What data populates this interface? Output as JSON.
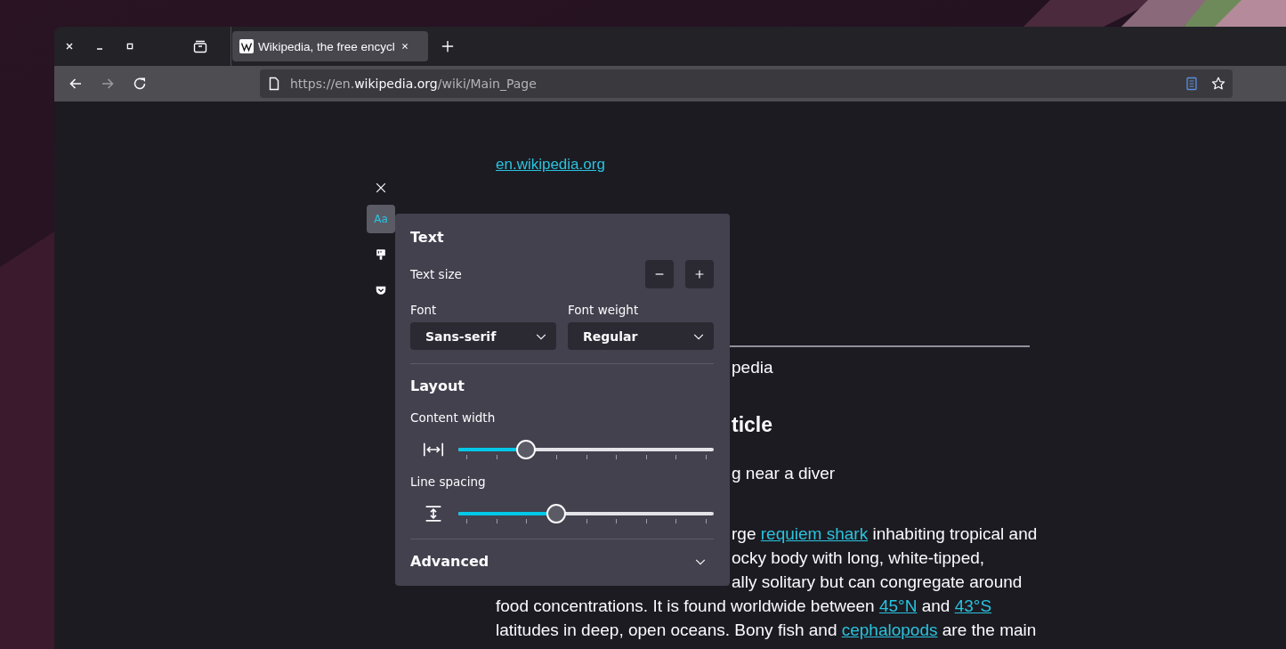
{
  "tab": {
    "title": "Wikipedia, the free encycl",
    "selected": true
  },
  "toolbar": {
    "forward_disabled": true,
    "url": {
      "prefix": "https://en.",
      "domain": "wikipedia.org",
      "path": "/wiki/Main_Page"
    }
  },
  "reader_sidebar": [
    {
      "kind": "text",
      "label": "Aa",
      "selected": true
    },
    {
      "kind": "theme",
      "selected": false
    },
    {
      "kind": "pocket",
      "selected": false
    }
  ],
  "text_panel": {
    "title": "Text",
    "text_size_label": "Text size",
    "font": {
      "label": "Font",
      "value": "Sans-serif"
    },
    "font_weight": {
      "label": "Font weight",
      "value": "Regular"
    },
    "layout_title": "Layout",
    "sliders": [
      {
        "kind": "width",
        "label": "Content width",
        "level": 0.25
      },
      {
        "kind": "spacing",
        "label": "Line spacing",
        "level": 0.375
      }
    ],
    "advanced": {
      "label": "Advanced",
      "expanded": false
    }
  },
  "article": {
    "source_link": "en.wikipedia.org",
    "lines": [
      {
        "kind": "subtitle",
        "clipped": true,
        "segments": [
          {
            "kind": "text",
            "text": "pedia"
          }
        ]
      },
      {
        "kind": "heading",
        "clipped": true,
        "segments": [
          {
            "kind": "text",
            "text": "ticle"
          }
        ]
      },
      {
        "kind": "caption",
        "clipped": true,
        "segments": [
          {
            "kind": "text",
            "text": "g near a diver"
          }
        ]
      },
      {
        "kind": "body",
        "clipped": true,
        "segments": [
          {
            "kind": "text",
            "text": "rge "
          },
          {
            "kind": "link",
            "text": "requiem shark"
          },
          {
            "kind": "text",
            "text": " inhabiting tropical and"
          }
        ]
      },
      {
        "kind": "body",
        "clipped": true,
        "segments": [
          {
            "kind": "text",
            "text": "ocky body with long, white-tipped,"
          }
        ]
      },
      {
        "kind": "body",
        "clipped": true,
        "segments": [
          {
            "kind": "text",
            "text": "ally solitary but can congregate around"
          }
        ]
      },
      {
        "kind": "body",
        "segments": [
          {
            "kind": "text",
            "text": "food concentrations. It is found worldwide between "
          },
          {
            "kind": "link",
            "text": "45°N"
          },
          {
            "kind": "text",
            "text": " and "
          },
          {
            "kind": "link",
            "text": "43°S"
          }
        ]
      },
      {
        "kind": "body",
        "segments": [
          {
            "kind": "text",
            "text": "latitudes in deep, open oceans. Bony fish and "
          },
          {
            "kind": "link",
            "text": "cephalopods"
          },
          {
            "kind": "text",
            "text": " are the main"
          }
        ]
      }
    ]
  }
}
